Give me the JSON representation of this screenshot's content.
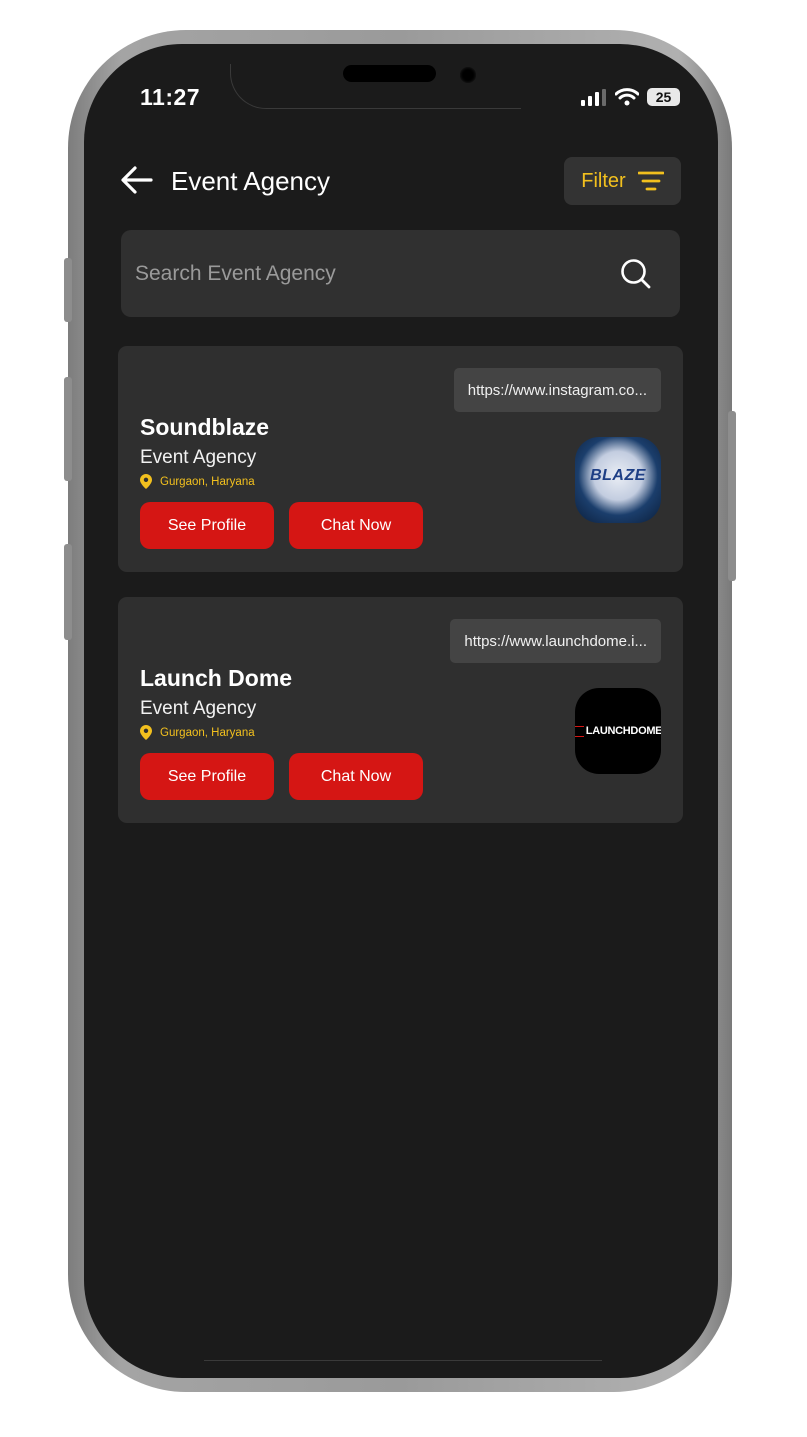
{
  "status_bar": {
    "time": "11:27",
    "battery": "25"
  },
  "header": {
    "title": "Event Agency",
    "filter_label": "Filter"
  },
  "search": {
    "placeholder": "Search Event Agency"
  },
  "cards": [
    {
      "url": "https://www.instagram.co...",
      "name": "Soundblaze",
      "category": "Event Agency",
      "location": "Gurgaon, Haryana",
      "profile_label": "See Profile",
      "chat_label": "Chat Now",
      "logo_text": "BLAZE"
    },
    {
      "url": "https://www.launchdome.i...",
      "name": "Launch Dome",
      "category": "Event Agency",
      "location": "Gurgaon, Haryana",
      "profile_label": "See Profile",
      "chat_label": "Chat Now",
      "logo_text": "LAUNCHDOME"
    }
  ],
  "colors": {
    "accent_red": "#d51614",
    "accent_yellow": "#f2c01e",
    "background": "#1b1b1b",
    "card": "#2f2f2f"
  }
}
